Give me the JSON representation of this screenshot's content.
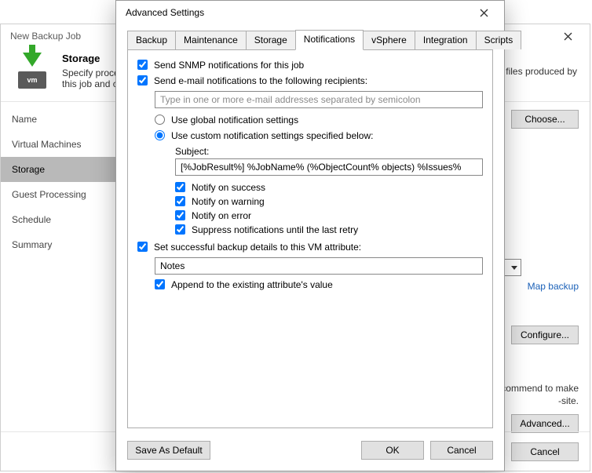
{
  "backDialog": {
    "title": "New Backup Job",
    "step": {
      "title": "Storage",
      "desc_visible_left": "Specify proce",
      "desc_visible_right": "files produced by",
      "desc_line2": "this job and c"
    },
    "sidebar": {
      "items": [
        {
          "label": "Name"
        },
        {
          "label": "Virtual Machines"
        },
        {
          "label": "Storage"
        },
        {
          "label": "Guest Processing"
        },
        {
          "label": "Schedule"
        },
        {
          "label": "Summary"
        }
      ],
      "selectedIndex": 2
    },
    "buttons": {
      "choose": "Choose...",
      "configure": "Configure...",
      "advanced": "Advanced...",
      "cancel": "Cancel"
    },
    "mapLink": "Map backup",
    "recommend_text_a": "commend to make",
    "recommend_text_b": "-site.",
    "vm_badge": "vm"
  },
  "frontDialog": {
    "title": "Advanced Settings",
    "tabs": [
      "Backup",
      "Maintenance",
      "Storage",
      "Notifications",
      "vSphere",
      "Integration",
      "Scripts"
    ],
    "activeTabIndex": 3,
    "notifications": {
      "snmp_checked": true,
      "snmp_label": "Send SNMP notifications for this job",
      "email_checked": true,
      "email_label": "Send e-mail notifications to the following recipients:",
      "email_placeholder": "Type in one or more e-mail addresses separated by semicolon",
      "email_value": "",
      "mode_selected": "custom",
      "global_label": "Use global notification settings",
      "custom_label": "Use custom notification settings specified below:",
      "subject_label": "Subject:",
      "subject_value": "[%JobResult%] %JobName% (%ObjectCount% objects) %Issues%",
      "notify_success": {
        "checked": true,
        "label": "Notify on success"
      },
      "notify_warning": {
        "checked": true,
        "label": "Notify on warning"
      },
      "notify_error": {
        "checked": true,
        "label": "Notify on error"
      },
      "suppress_retry": {
        "checked": true,
        "label": "Suppress notifications until the last retry"
      },
      "set_attr_checked": true,
      "set_attr_label": "Set successful backup details to this VM attribute:",
      "attr_value": "Notes",
      "append_checked": true,
      "append_label": "Append to the existing attribute's value"
    },
    "buttons": {
      "save_default": "Save As Default",
      "ok": "OK",
      "cancel": "Cancel"
    }
  }
}
